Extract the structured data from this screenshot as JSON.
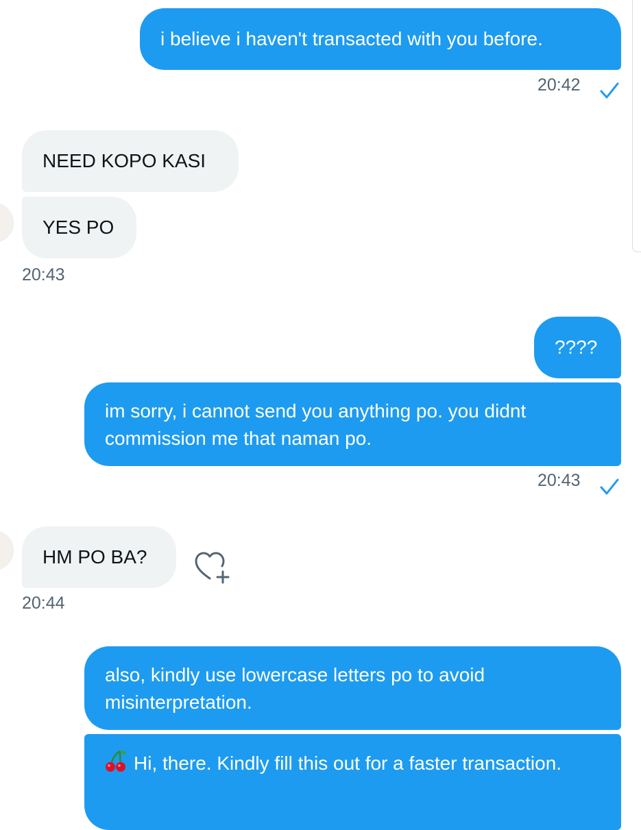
{
  "messages": [
    {
      "id": "m1",
      "dir": "out",
      "text": "i believe i haven't transacted with you before."
    },
    {
      "id": "m2",
      "dir": "in",
      "text": "NEED KOPO KASI"
    },
    {
      "id": "m3",
      "dir": "in",
      "text": "YES PO"
    },
    {
      "id": "m4",
      "dir": "out",
      "text": "????"
    },
    {
      "id": "m5",
      "dir": "out",
      "text": "im sorry, i cannot send you anything po. you didnt commission me that naman po."
    },
    {
      "id": "m6",
      "dir": "in",
      "text": "HM PO BA?"
    },
    {
      "id": "m7",
      "dir": "out",
      "text": "also, kindly use lowercase letters po to avoid misinterpretation."
    },
    {
      "id": "m8",
      "dir": "out",
      "text": "Hi, there. Kindly fill this out for a faster transaction.",
      "emoji": "cherries"
    }
  ],
  "timestamps": {
    "t1": "20:42",
    "t2": "20:43",
    "t3": "20:43",
    "t4": "20:44"
  },
  "icons": {
    "read_receipt": "checkmark-icon",
    "react": "heart-add-icon",
    "emoji": "cherries-icon"
  },
  "colors": {
    "outgoing_bubble": "#1d9bf0",
    "incoming_bubble": "#eff3f4",
    "timestamp": "#536471",
    "check": "#1d9bf0"
  }
}
